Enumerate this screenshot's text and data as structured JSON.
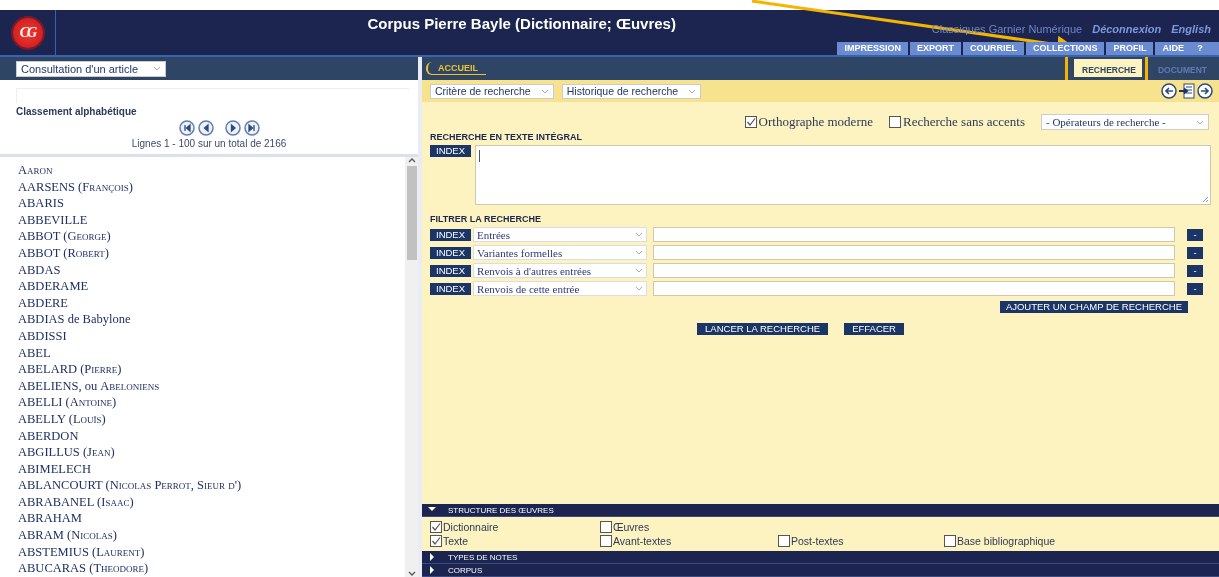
{
  "header": {
    "logo_text": "CG",
    "title": "Corpus Pierre Bayle (Dictionnaire; Œuvres)",
    "links": [
      {
        "label": "Classiques Garnier Numérique",
        "kind": "plain"
      },
      {
        "label": "Déconnexion",
        "kind": "italic"
      },
      {
        "label": "English",
        "kind": "italic"
      }
    ],
    "menu": [
      {
        "label": "IMPRESSION"
      },
      {
        "label": "EXPORT"
      },
      {
        "label": "COURRIEL"
      },
      {
        "label": "COLLECTIONS"
      },
      {
        "label": "PROFIL"
      },
      {
        "label": "AIDE",
        "help": "?"
      }
    ]
  },
  "left": {
    "mode_select": "Consultation d'un article",
    "heading": "Classement alphabétique",
    "pager": "Lignes 1 - 100 sur un total de 2166",
    "entries": [
      {
        "head": "A",
        "tail": "aron"
      },
      {
        "head": "AARSENS (",
        "tail": "François)"
      },
      {
        "head": "ABARIS"
      },
      {
        "head": "ABBEVILLE"
      },
      {
        "head": "ABBOT (",
        "tail": "George)"
      },
      {
        "head": "ABBOT (",
        "tail": "Robert)"
      },
      {
        "head": "ABDAS"
      },
      {
        "head": "ABDERAME"
      },
      {
        "head": "ABDERE"
      },
      {
        "head": "ABDIAS de Babylone"
      },
      {
        "head": "ABDISSI"
      },
      {
        "head": "ABEL"
      },
      {
        "head": "ABELARD (",
        "tail": "Pierre)"
      },
      {
        "head": "ABELIENS, ou ",
        "tail": "Abeloniens"
      },
      {
        "head": "ABELLI (",
        "tail": "Antoine)"
      },
      {
        "head": "ABELLY (",
        "tail": "Louïs)"
      },
      {
        "head": "ABERDON"
      },
      {
        "head": "ABGILLUS (",
        "tail": "Jean)"
      },
      {
        "head": "ABIMELECH"
      },
      {
        "head": "ABLANCOURT (",
        "tail": "Nicolas Perrot, Sieur d')"
      },
      {
        "head": "ABRABANEL (",
        "tail": "Isaac)"
      },
      {
        "head": "ABRAHAM"
      },
      {
        "head": "ABRAM (",
        "tail": "Nicolas)"
      },
      {
        "head": "ABSTEMIUS (",
        "tail": "Laurent)"
      },
      {
        "head": "ABUCARAS (",
        "tail": "Theodore)"
      }
    ]
  },
  "right": {
    "breadcrumb": "ACCUEIL",
    "tabs": [
      {
        "label": "RECHERCHE",
        "selected": true
      },
      {
        "label": "DOCUMENT",
        "selected": false
      }
    ],
    "selects": [
      "Critère de recherche",
      "Historique de recherche"
    ],
    "options": [
      {
        "label": "Orthographe moderne",
        "checked": true
      },
      {
        "label": "Recherche sans accents",
        "checked": false
      }
    ],
    "operators": "- Opérateurs de recherche -",
    "fulltext": {
      "heading": "RECHERCHE EN TEXTE INTÉGRAL",
      "index": "INDEX"
    },
    "filter": {
      "heading": "FILTRER LA RECHERCHE",
      "rows": [
        {
          "index": "INDEX",
          "field": "Entrées",
          "remove": "-"
        },
        {
          "index": "INDEX",
          "field": "Variantes formelles",
          "remove": "-"
        },
        {
          "index": "INDEX",
          "field": "Renvois à d'autres entrées",
          "remove": "-"
        },
        {
          "index": "INDEX",
          "field": "Renvois de cette entrée",
          "remove": "-"
        }
      ],
      "add": "AJOUTER UN CHAMP DE RECHERCHE"
    },
    "actions": [
      "LANCER LA RECHERCHE",
      "EFFACER"
    ],
    "sections": [
      {
        "title": "STRUCTURE DES ŒUVRES",
        "expanded": true,
        "rows": [
          [
            {
              "label": "Dictionnaire",
              "checked": true
            },
            {
              "label": "Œuvres",
              "checked": false
            }
          ],
          [
            {
              "label": "Texte",
              "checked": true
            },
            {
              "label": "Avant-textes",
              "checked": false
            },
            {
              "label": "Post-textes",
              "checked": false
            },
            {
              "label": "Base bibliographique",
              "checked": false
            }
          ]
        ]
      },
      {
        "title": "TYPES DE NOTES",
        "expanded": false
      },
      {
        "title": "CORPUS",
        "expanded": false
      }
    ]
  }
}
